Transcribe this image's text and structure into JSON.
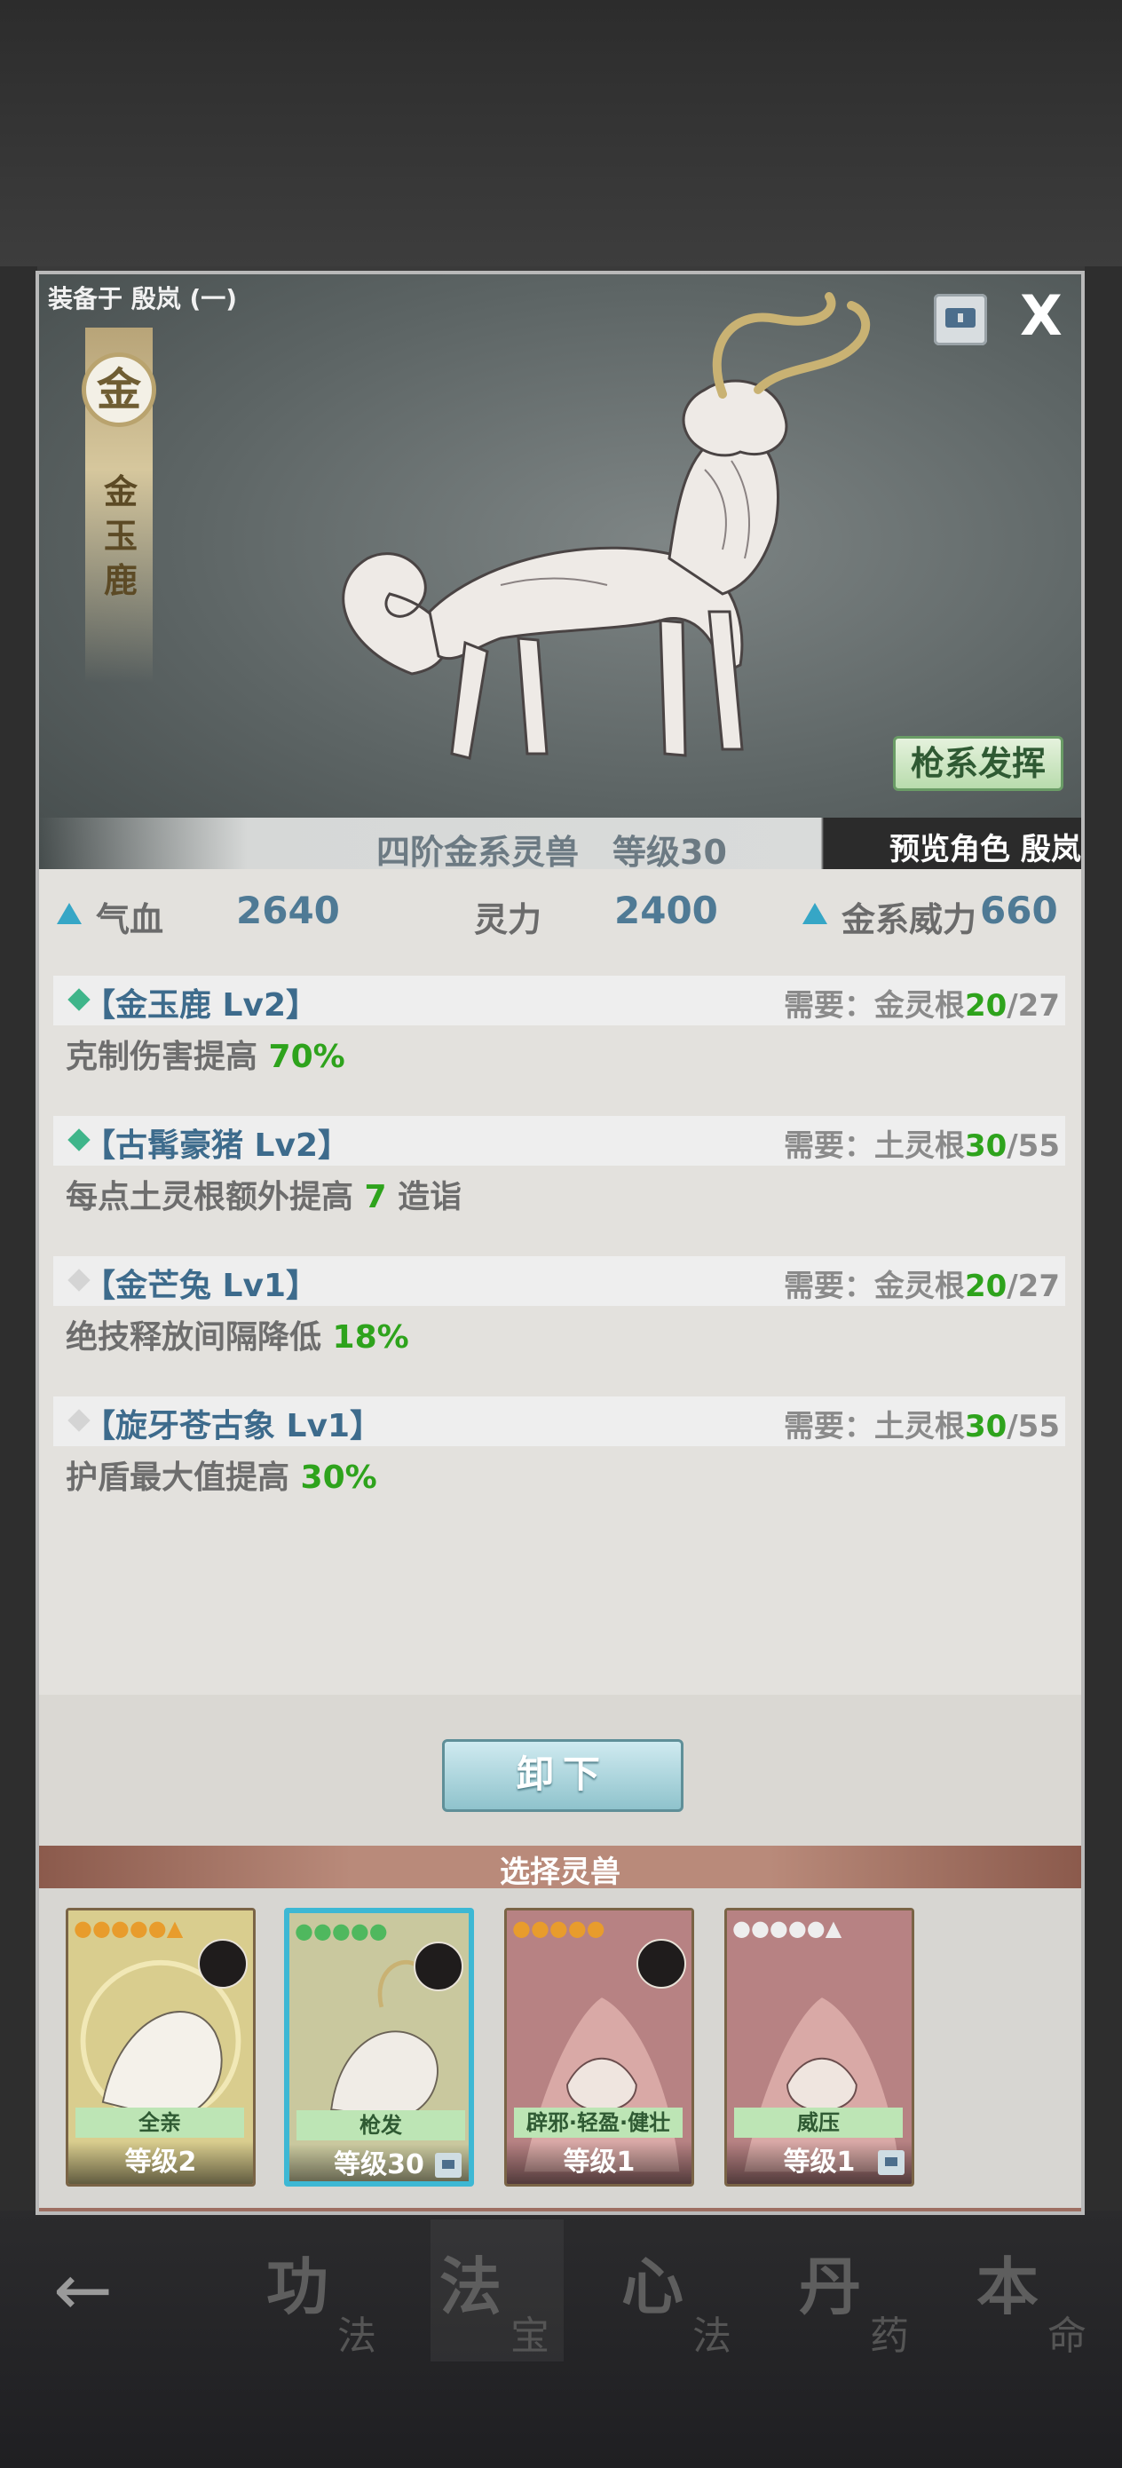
{
  "dialog": {
    "equipped_label": "装备于 殷岚 (一)",
    "close_label": "X",
    "element_badge": "金",
    "beast_name": "金玉鹿",
    "skill_button": "枪系发挥",
    "level_text": "四阶金系灵兽　等级30",
    "preview_text": "预览角色 殷岚"
  },
  "stats": [
    {
      "label": "气血",
      "value": "2640",
      "arrow": true
    },
    {
      "label": "灵力",
      "value": "2400",
      "arrow": false
    },
    {
      "label": "金系威力",
      "value": "660",
      "arrow": true
    }
  ],
  "skills": [
    {
      "name": "【金玉鹿 Lv2】",
      "req_prefix": "需要：金灵根",
      "req_have": "20",
      "req_total": "/27",
      "desc": "克制伤害提高 ",
      "desc_num": "70%",
      "desc_suffix": "",
      "active": true
    },
    {
      "name": "【古髯豪猪 Lv2】",
      "req_prefix": "需要：土灵根",
      "req_have": "30",
      "req_total": "/55",
      "desc": "每点土灵根额外提高 ",
      "desc_num": "7",
      "desc_suffix": " 造诣",
      "active": true
    },
    {
      "name": "【金芒兔 Lv1】",
      "req_prefix": "需要：金灵根",
      "req_have": "20",
      "req_total": "/27",
      "desc": "绝技释放间隔降低 ",
      "desc_num": "18%",
      "desc_suffix": "",
      "active": false
    },
    {
      "name": "【旋牙苍古象 Lv1】",
      "req_prefix": "需要：土灵根",
      "req_have": "30",
      "req_total": "/55",
      "desc": "护盾最大值提高 ",
      "desc_num": "30%",
      "desc_suffix": "",
      "active": false
    }
  ],
  "unequip_button": "卸下",
  "select_title": "选择灵兽",
  "cards": [
    {
      "tag": "全亲",
      "level": "等级2",
      "stars": "●●●●●▲",
      "locked": false
    },
    {
      "tag": "枪发",
      "level": "等级30",
      "stars": "●●●●●",
      "locked": true
    },
    {
      "tag": "辟邪·轻盈·健壮",
      "level": "等级1",
      "stars": "●●●●●",
      "locked": false
    },
    {
      "tag": "威压",
      "level": "等级1",
      "stars": "●●●●●▲",
      "locked": true
    }
  ],
  "bottom_nav": [
    {
      "big": "功",
      "small": "法"
    },
    {
      "big": "法",
      "small": "宝"
    },
    {
      "big": "心",
      "small": "法"
    },
    {
      "big": "丹",
      "small": "药"
    },
    {
      "big": "本",
      "small": "命"
    }
  ],
  "colors": {
    "accent_green": "#2ea31c",
    "skill_blue": "#3d6b8c",
    "stat_blue": "#4f7a95",
    "selected_border": "#3db8d4"
  }
}
